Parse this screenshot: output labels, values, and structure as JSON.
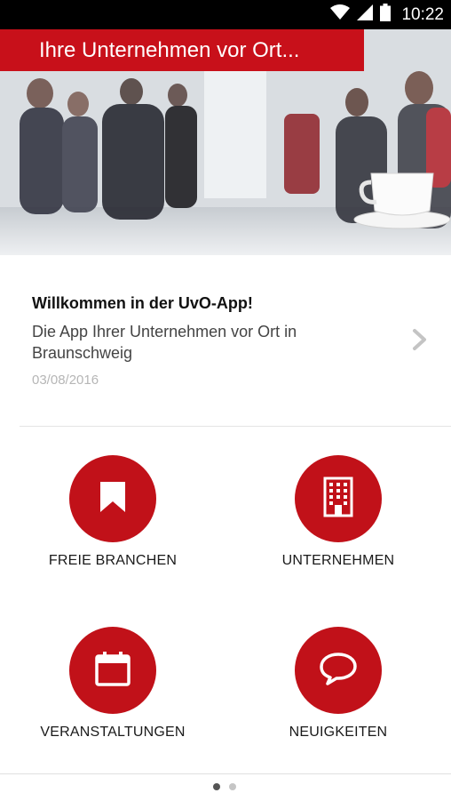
{
  "status_bar": {
    "time": "10:22",
    "icons": [
      "wifi-icon",
      "cell-signal-icon",
      "battery-icon"
    ]
  },
  "hero": {
    "banner_text": "Ihre Unternehmen vor Ort..."
  },
  "news": {
    "title": "Willkommen in der UvO-App!",
    "text": "Die App Ihrer Unternehmen vor Ort in Braunschweig",
    "date": "03/08/2016",
    "chevron_icon": "chevron-right-icon"
  },
  "tiles": [
    {
      "label": "FREIE BRANCHEN",
      "icon": "bookmark-icon"
    },
    {
      "label": "UNTERNEHMEN",
      "icon": "building-icon"
    },
    {
      "label": "VERANSTALTUNGEN",
      "icon": "calendar-icon"
    },
    {
      "label": "NEUIGKEITEN",
      "icon": "speech-bubble-icon"
    }
  ],
  "pager": {
    "pages": 2,
    "active_index": 0
  },
  "colors": {
    "accent": "#c11119",
    "banner": "#c8101a",
    "status_bar": "#000000"
  }
}
